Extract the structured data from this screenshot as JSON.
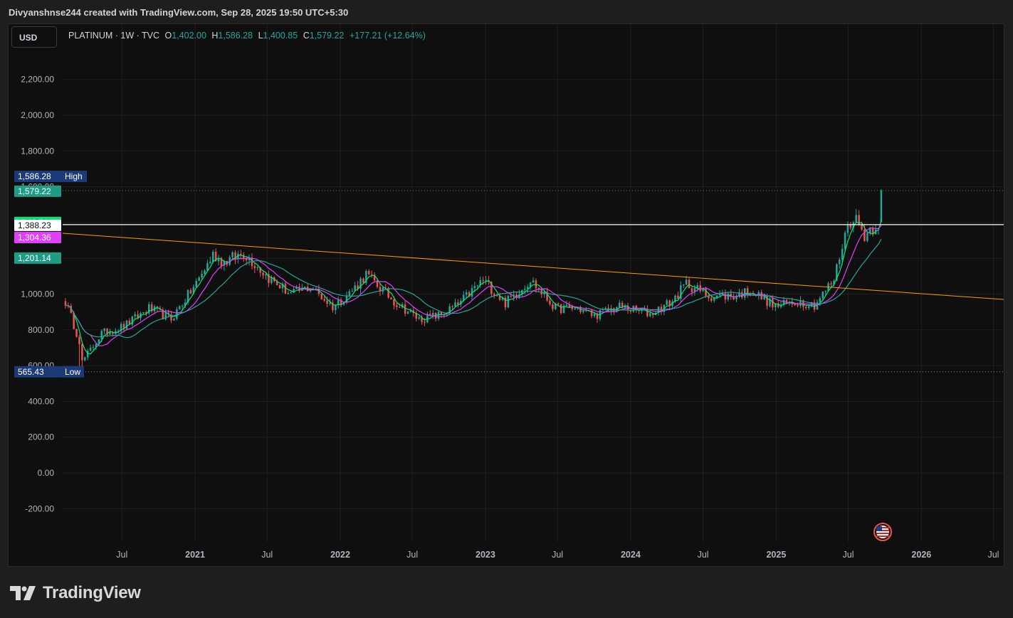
{
  "header": {
    "attribution": "Divyanshnse244 created with TradingView.com, Sep 28, 2025 19:50 UTC+5:30"
  },
  "toolbar": {
    "currency_label": "USD"
  },
  "legend": {
    "symbol": "PLATINUM · 1W · TVC",
    "open_label": "O",
    "open": "1,402.00",
    "high_label": "H",
    "high": "1,586.28",
    "low_label": "L",
    "low": "1,400.85",
    "close_label": "C",
    "close": "1,579.22",
    "change": "+177.21 (+12.64%)",
    "up_color": "#26a69a"
  },
  "footer": {
    "brand": "TradingView"
  },
  "icons": {
    "brand_logo": "tradingview-logo-icon",
    "flag": "us-flag-icon"
  },
  "chart_data": {
    "type": "candlestick",
    "instrument": "PLATINUM",
    "interval": "1W",
    "source": "TVC",
    "currency": "USD",
    "ylim": [
      -400,
      2400
    ],
    "y_ticks": [
      "2,200.00",
      "2,000.00",
      "1,800.00",
      "1,600.00",
      "1,400.00",
      "1,200.00",
      "1,000.00",
      "800.00",
      "600.00",
      "400.00",
      "200.00",
      "0.00",
      "-200.00"
    ],
    "y_tick_values": [
      2200,
      2000,
      1800,
      1600,
      1400,
      1200,
      1000,
      800,
      600,
      400,
      200,
      0,
      -200
    ],
    "x_range": [
      "2020-02-03",
      "2026-07-27"
    ],
    "x_ticks": [
      {
        "label": "Jul",
        "date": "2020-07-01",
        "bold": false
      },
      {
        "label": "2021",
        "date": "2021-01-01",
        "bold": true
      },
      {
        "label": "Jul",
        "date": "2021-07-01",
        "bold": false
      },
      {
        "label": "2022",
        "date": "2022-01-01",
        "bold": true
      },
      {
        "label": "Jul",
        "date": "2022-07-01",
        "bold": false
      },
      {
        "label": "2023",
        "date": "2023-01-01",
        "bold": true
      },
      {
        "label": "Jul",
        "date": "2023-07-01",
        "bold": false
      },
      {
        "label": "2024",
        "date": "2024-01-01",
        "bold": true
      },
      {
        "label": "Jul",
        "date": "2024-07-01",
        "bold": false
      },
      {
        "label": "2025",
        "date": "2025-01-01",
        "bold": true
      },
      {
        "label": "Jul",
        "date": "2025-07-01",
        "bold": false
      },
      {
        "label": "2026",
        "date": "2026-01-01",
        "bold": true
      },
      {
        "label": "Jul",
        "date": "2026-07-01",
        "bold": false
      }
    ],
    "anchors": [
      [
        "2020-02-10",
        960
      ],
      [
        "2020-03-16",
        740
      ],
      [
        "2020-03-23",
        620
      ],
      [
        "2020-05-11",
        780
      ],
      [
        "2020-07-06",
        820
      ],
      [
        "2020-09-07",
        920
      ],
      [
        "2020-11-02",
        860
      ],
      [
        "2021-01-04",
        1060
      ],
      [
        "2021-02-15",
        1220
      ],
      [
        "2021-03-15",
        1180
      ],
      [
        "2021-05-03",
        1230
      ],
      [
        "2021-05-31",
        1170
      ],
      [
        "2021-07-05",
        1090
      ],
      [
        "2021-08-30",
        1000
      ],
      [
        "2021-10-18",
        1040
      ],
      [
        "2021-12-13",
        930
      ],
      [
        "2022-01-31",
        1020
      ],
      [
        "2022-03-07",
        1110
      ],
      [
        "2022-05-16",
        960
      ],
      [
        "2022-07-18",
        860
      ],
      [
        "2022-09-05",
        880
      ],
      [
        "2022-10-24",
        940
      ],
      [
        "2022-12-26",
        1080
      ],
      [
        "2023-02-20",
        950
      ],
      [
        "2023-04-24",
        1080
      ],
      [
        "2023-06-26",
        920
      ],
      [
        "2023-08-21",
        920
      ],
      [
        "2023-10-02",
        880
      ],
      [
        "2023-12-04",
        930
      ],
      [
        "2024-02-19",
        890
      ],
      [
        "2024-04-15",
        960
      ],
      [
        "2024-05-20",
        1060
      ],
      [
        "2024-07-15",
        990
      ],
      [
        "2024-09-16",
        990
      ],
      [
        "2024-10-28",
        1020
      ],
      [
        "2024-12-30",
        930
      ],
      [
        "2025-02-24",
        960
      ],
      [
        "2025-04-07",
        940
      ],
      [
        "2025-05-26",
        1080
      ],
      [
        "2025-06-23",
        1340
      ],
      [
        "2025-07-14",
        1440
      ],
      [
        "2025-08-11",
        1330
      ],
      [
        "2025-09-15",
        1402
      ],
      [
        "2025-09-22",
        1579.22
      ]
    ],
    "last_candle": {
      "date": "2025-09-22",
      "open": 1402.0,
      "high": 1586.28,
      "low": 1400.85,
      "close": 1579.22
    },
    "trendline": {
      "start": {
        "date": "2020-02-03",
        "value": 1340
      },
      "end": {
        "date": "2026-07-27",
        "value": 970
      },
      "color": "#ff9800"
    },
    "horizontal_line": {
      "value": 1388.23,
      "color": "#ffffff"
    },
    "moving_averages": [
      {
        "value": "1,395.91",
        "color": "#00e676",
        "window": 4
      },
      {
        "value": "1,304.36",
        "color": "#e040fb",
        "window": 10
      },
      {
        "value": "1,201.14",
        "color": "#26a69a",
        "window": 20
      }
    ],
    "high_marker": {
      "value_label": "1,586.28",
      "text": "High",
      "value": 1586.28
    },
    "low_marker": {
      "value_label": "565.43",
      "text": "Low",
      "value": 565.43
    },
    "close_label": "1,579.22",
    "line_label": "1,388.23",
    "colors": {
      "up": "#26a69a",
      "down": "#ef5350",
      "grid": "#1f1f1f",
      "axis_text": "#b2b5be"
    }
  }
}
